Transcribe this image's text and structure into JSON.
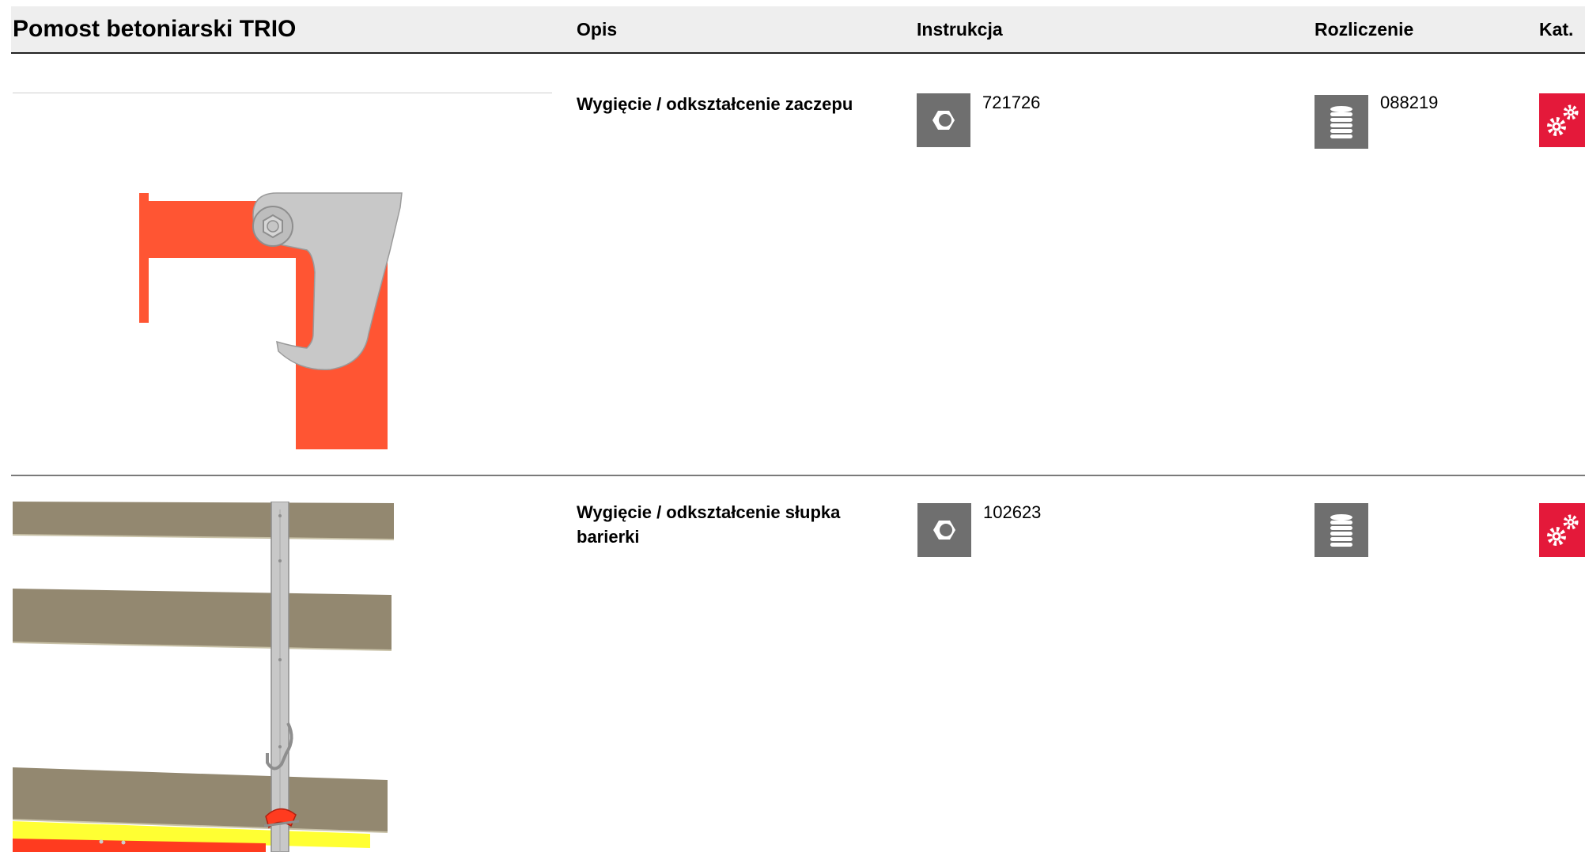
{
  "header": {
    "title": "Pomost betoniarski TRIO",
    "columns": {
      "opis": "Opis",
      "instrukcja": "Instrukcja",
      "rozliczenie": "Rozliczenie",
      "kat": "Kat."
    }
  },
  "rows": [
    {
      "description": "Wygięcie / odkształcenie zaczepu",
      "instruction_code": "721726",
      "settlement_code": "088219",
      "icons": {
        "instruction": "hex-nut-icon",
        "settlement": "coin-stack-icon",
        "category": "gears-icon"
      }
    },
    {
      "description": "Wygięcie / odkształcenie słupka barierki",
      "instruction_code": "102623",
      "settlement_code": "",
      "icons": {
        "instruction": "hex-nut-icon",
        "settlement": "coin-stack-icon",
        "category": "gears-icon"
      }
    }
  ],
  "colors": {
    "header_bg": "#eeeeee",
    "icon_gray": "#6f6f6f",
    "category_red": "#e4193a",
    "part_orange": "#ff5533",
    "part_silver": "#c8c8c8",
    "board_brown": "#938870",
    "toeboard_yellow": "#ffff33"
  }
}
